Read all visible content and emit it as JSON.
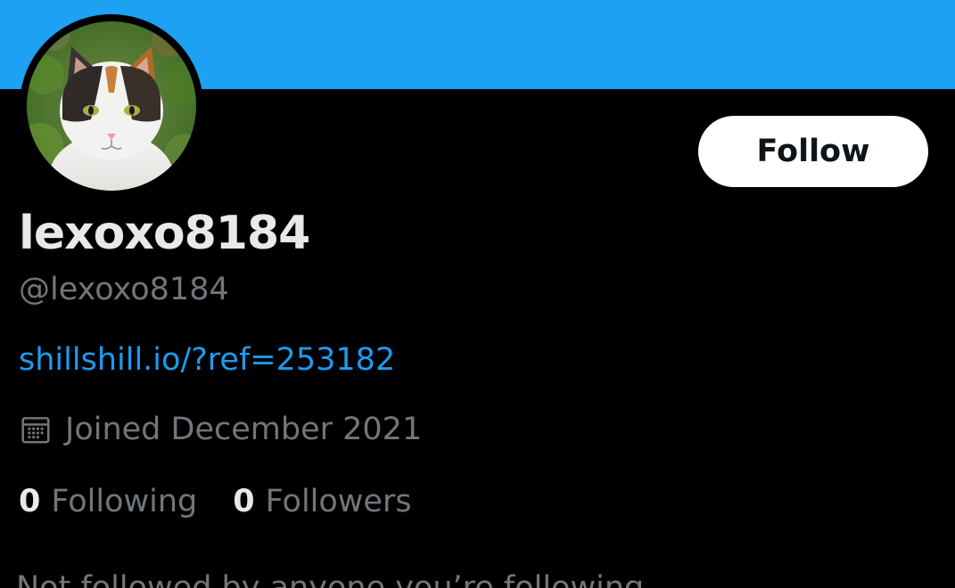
{
  "profile": {
    "display_name": "lexoxo8184",
    "handle": "@lexoxo8184",
    "link_text": "shillshill.io/?ref=253182",
    "joined_text": "Joined December 2021",
    "joined_icon": "calendar-icon",
    "avatar_description_icon": "cat-avatar"
  },
  "actions": {
    "follow_label": "Follow"
  },
  "stats": {
    "following_count": "0",
    "following_label": "Following",
    "followers_count": "0",
    "followers_label": "Followers"
  },
  "social_context": {
    "text": "Not followed by anyone you’re following"
  },
  "colors": {
    "banner": "#1da1f2",
    "background": "#000000",
    "link": "#1d9bf0",
    "primary_text": "#e7e9ea",
    "secondary_text": "#71767b",
    "follow_button_bg": "#ffffff"
  }
}
